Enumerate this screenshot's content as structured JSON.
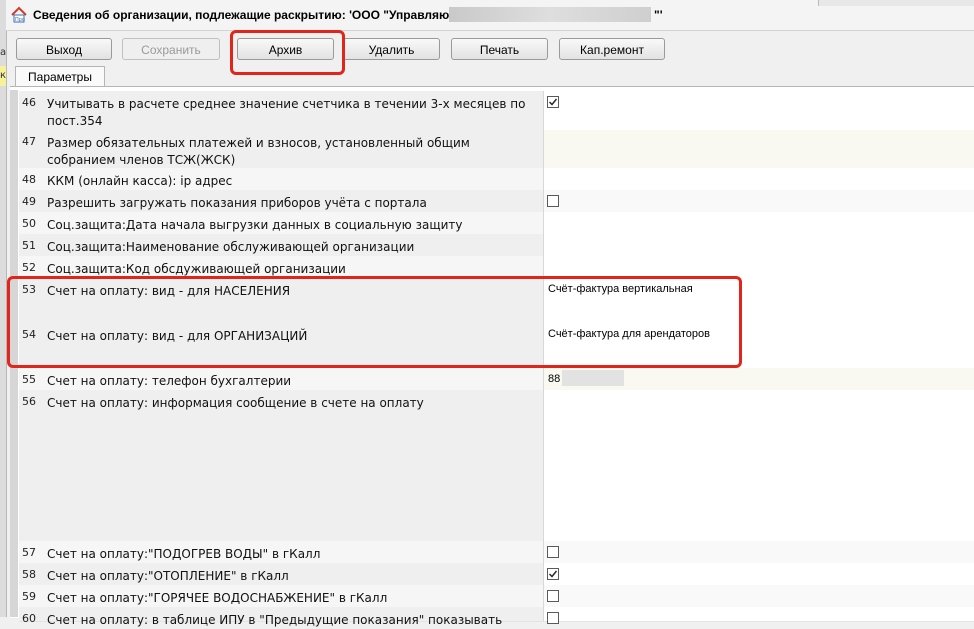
{
  "window": {
    "title": "Сведения об организации, подлежащие раскрытию: 'ООО \"Управляющ",
    "title_tail": "\"'"
  },
  "toolbar": {
    "exit_label": "Выход",
    "save_label": "Сохранить",
    "archive_label": "Архив",
    "delete_label": "Удалить",
    "print_label": "Печать",
    "capital_repair_label": "Кап.ремонт"
  },
  "tabs": [
    {
      "label": "Параметры"
    }
  ],
  "left_strip": {
    "chars": [
      "a",
      "к"
    ]
  },
  "rows": [
    {
      "num": "46",
      "name": "Учитывать в расчете среднее значение счетчика в течении 3-х месяцев по пост.354",
      "type": "checkbox",
      "checked": true
    },
    {
      "num": "47",
      "name": "Размер обязательных платежей и взносов, установленный общим собранием членов ТСЖ(ЖСК)",
      "type": "text",
      "value": ""
    },
    {
      "num": "48",
      "name": "ККМ (онлайн касса): ip адрес",
      "type": "text",
      "value": ""
    },
    {
      "num": "49",
      "name": "Разрешить загружать показания приборов учёта с портала",
      "type": "checkbox",
      "checked": false
    },
    {
      "num": "50",
      "name": "Соц.защита:Дата начала выгрузки данных в социальную защиту",
      "type": "text",
      "value": ""
    },
    {
      "num": "51",
      "name": "Соц.защита:Наименование обслуживающей организации",
      "type": "text",
      "value": ""
    },
    {
      "num": "52",
      "name": "Соц.защита:Код обсдуживающей организации",
      "type": "text",
      "value": ""
    },
    {
      "num": "53",
      "name": "Счет на оплату: вид - для НАСЕЛЕНИЯ",
      "type": "text",
      "value": "Счёт-фактура вертикальная"
    },
    {
      "num": "54",
      "name": "Счет на оплату: вид - для ОРГАНИЗАЦИЙ",
      "type": "text",
      "value": "Счёт-фактура для арендаторов"
    },
    {
      "num": "55",
      "name": "Счет на оплату: телефон бухгалтерии",
      "type": "text",
      "value": "88"
    },
    {
      "num": "56",
      "name": "Счет на оплату: информация сообщение в счете на оплату",
      "type": "text",
      "value": ""
    },
    {
      "num": "57",
      "name": "Счет на оплату:\"ПОДОГРЕВ ВОДЫ\" в гКалл",
      "type": "checkbox",
      "checked": false
    },
    {
      "num": "58",
      "name": "Счет на оплату:\"ОТОПЛЕНИЕ\" в гКалл",
      "type": "checkbox",
      "checked": true
    },
    {
      "num": "59",
      "name": "Счет на оплату:\"ГОРЯЧЕЕ ВОДОСНАБЖЕНИЕ\" в гКалл",
      "type": "checkbox",
      "checked": false
    },
    {
      "num": "60",
      "name": "Счет на оплату: в таблице ИПУ в \"Предыдущие показания\" показывать",
      "type": "checkbox",
      "checked": false
    }
  ],
  "colors": {
    "highlight": "#e1251b",
    "check": "#2a2a2a"
  },
  "icons": {
    "app": "house-icon",
    "check": "checkmark-icon"
  }
}
